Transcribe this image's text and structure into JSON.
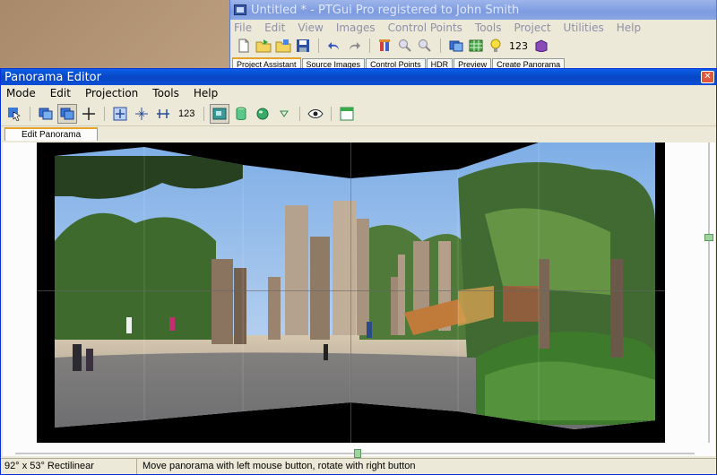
{
  "main_window": {
    "title": "Untitled * - PTGui Pro registered to John Smith",
    "menu": [
      "File",
      "Edit",
      "View",
      "Images",
      "Control Points",
      "Tools",
      "Project",
      "Utilities",
      "Help"
    ],
    "toolbar": {
      "icons": [
        "new-file-icon",
        "open-folder-icon",
        "open-recent-icon",
        "save-icon",
        "undo-icon",
        "redo-icon",
        "optimize-tool-icon",
        "zoom-in-icon",
        "zoom-out-icon",
        "panorama-editor-icon",
        "table-icon",
        "lightbulb-icon",
        "number-display-icon",
        "help-book-icon"
      ],
      "number_label": "123"
    },
    "tabs": [
      "Project Assistant",
      "Source Images",
      "Control Points",
      "HDR",
      "Preview",
      "Create Panorama"
    ],
    "active_tab": "Project Assistant"
  },
  "editor": {
    "title": "Panorama Editor",
    "close_glyph": "✕",
    "menu": [
      "Mode",
      "Edit",
      "Projection",
      "Tools",
      "Help"
    ],
    "toolbar": {
      "number_label": "123",
      "icons": [
        "select-arrow-icon",
        "image-stack-icon",
        "image-stack-active-icon",
        "crosshair-icon",
        "fit-panorama-icon",
        "center-point-icon",
        "level-straighten-icon",
        "number-toggle-icon",
        "rectilinear-projection-icon",
        "cylindrical-projection-icon",
        "spherical-projection-icon",
        "projection-dropdown-icon",
        "preview-eye-icon",
        "window-icon"
      ]
    },
    "tab": "Edit Panorama",
    "status": {
      "fov": "92° x 53° Rectilinear",
      "hint": "Move panorama with left mouse button, rotate with right button"
    }
  },
  "colors": {
    "xp_blue": "#0a4fd6",
    "tab_accent": "#e4a42c",
    "slider_thumb": "#9fd39f"
  }
}
